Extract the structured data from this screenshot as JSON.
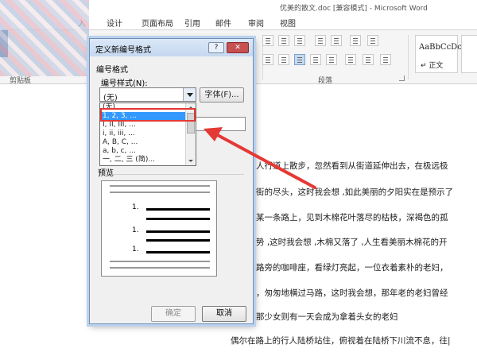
{
  "window": {
    "title": "优美的散文.doc [兼容模式] - Microsoft Word"
  },
  "tabs": [
    "入",
    "设计",
    "页面布局",
    "引用",
    "邮件",
    "审阅",
    "视图"
  ],
  "ribbon": {
    "clipboard_label": "剪贴板",
    "paragraph_label": "段落",
    "styles": [
      {
        "sample": "AaBbCcDc",
        "name": "↵ 正文"
      }
    ]
  },
  "dialog": {
    "title": "定义新编号格式",
    "help": "?",
    "close": "✕",
    "section_label": "编号格式",
    "style_label": "编号样式(N):",
    "style_value": "(无)",
    "font_button": "字体(F)...",
    "options": [
      "(无)",
      "1, 2, 3, ...",
      "I, II, III, ...",
      "i, ii, iii, ...",
      "A, B, C, ...",
      "a, b, c, ...",
      "一, 二, 三 (简)...",
      "..."
    ],
    "selected_option": "1, 2, 3, ...",
    "preview_label": "预览",
    "preview_numbers": [
      "1.",
      "1.",
      "1."
    ],
    "ok": "确定",
    "cancel": "取消"
  },
  "document": {
    "lines": [
      "人行道上散步，忽然看到从街道延伸出去，在极远极",
      "街的尽头，这时我会想 ,如此美丽的夕阳实在是预示了",
      "某一条路上，见到木棉花叶落尽的枯枝，深褐色的孤",
      "势 ,这时我会想 ,木棉又落了 ,人生看美丽木棉花的开",
      "路旁的咖啡座，看绿灯亮起，一位衣着素朴的老妇，",
      "，匆匆地横过马路，这时我会想，那年老的老妇曾经",
      "那少女则有一天会成为拿着头女的老妇",
      "偶尔在路上的行人陆桥站住，俯视着在陆桥下川流不息，往|"
    ]
  },
  "colors": {
    "accent": "#2b579a",
    "highlight": "#e53935",
    "selection": "#3399ff"
  }
}
